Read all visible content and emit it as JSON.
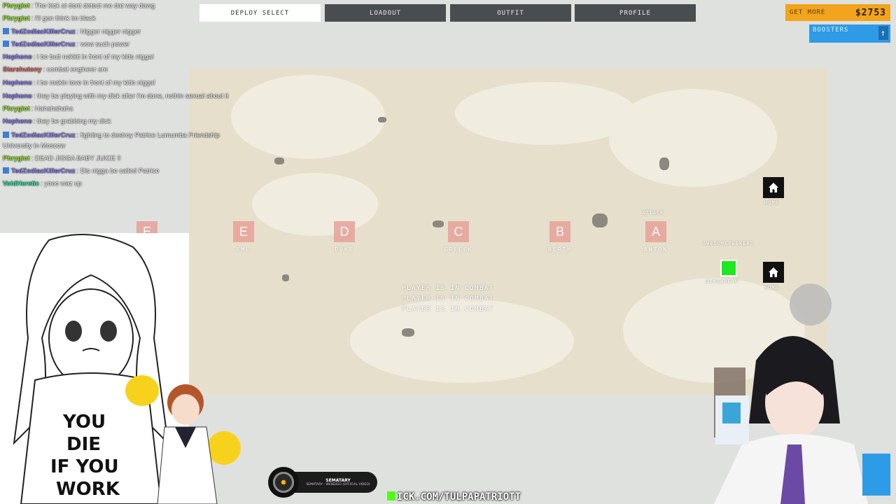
{
  "nav": {
    "tabs": [
      {
        "label": "DEPLOY SELECT",
        "active": true
      },
      {
        "label": "LOADOUT",
        "active": false
      },
      {
        "label": "OUTFIT",
        "active": false
      },
      {
        "label": "PROFILE",
        "active": false
      }
    ]
  },
  "currency": {
    "get_more_label": "GET MORE",
    "amount": "$2753",
    "accent": "#f2a41c"
  },
  "boosters": {
    "label": "BOOSTERS",
    "icon": "arrow-up-icon"
  },
  "map": {
    "flags": [
      {
        "letter": "E",
        "name": "EML"
      },
      {
        "letter": "D",
        "name": "DUKE"
      },
      {
        "letter": "C",
        "name": "CRECEK"
      },
      {
        "letter": "B",
        "name": "BERTH"
      },
      {
        "letter": "A",
        "name": "ANTON"
      }
    ],
    "combat_lines": [
      "PLAYER IS IN COMBAT",
      "PLAYER IS IN COMBAT",
      "PLAYER IS IN COMBAT"
    ],
    "home_label_1": "HOME",
    "home_label_2": "HOME",
    "attack_label": "ATTACK",
    "player_label": "DINGAREAU",
    "squad_label": "AWESOMEPEEKERS"
  },
  "chat": [
    {
      "user": "Phrygiot",
      "color": "#9ae62a",
      "badge": false,
      "msg": "The kick ai dont detect me dat way dawg"
    },
    {
      "user": "Phrygiot",
      "color": "#9ae62a",
      "badge": false,
      "msg": "i'll gon think im black"
    },
    {
      "user": "TedZodiacKillerCruz",
      "color": "#8a7cf0",
      "badge": true,
      "msg": "Nigger nigger nigger"
    },
    {
      "user": "TedZodiacKillerCruz",
      "color": "#8a7cf0",
      "badge": true,
      "msg": "wow such power"
    },
    {
      "user": "Hophono",
      "color": "#8a7cf0",
      "badge": false,
      "msg": "i be butt nekkit in front of my kids nigga!"
    },
    {
      "user": "Starshutony",
      "color": "#e07070",
      "badge": false,
      "msg": "combat engineer are"
    },
    {
      "user": "Hophono",
      "color": "#8a7cf0",
      "badge": false,
      "msg": "i be makin love in front of my kids nigga!"
    },
    {
      "user": "Hophono",
      "color": "#8a7cf0",
      "badge": false,
      "msg": "they be playing with my dick after i'm done, nothin sexual about it"
    },
    {
      "user": "Phrygiot",
      "color": "#9ae62a",
      "badge": false,
      "msg": "Hahahahaha"
    },
    {
      "user": "Hophono",
      "color": "#8a7cf0",
      "badge": false,
      "msg": "they be grabbing my dick"
    },
    {
      "user": "TedZodiacKillerCruz",
      "color": "#8a7cf0",
      "badge": true,
      "msg": "fighting to destroy Patrice Lumumba Friendship University in Moscow"
    },
    {
      "user": "Phrygiot",
      "color": "#9ae62a",
      "badge": false,
      "msg": "DEAD JIGGA BABY JUICE !!"
    },
    {
      "user": "TedZodiacKillerCruz",
      "color": "#8a7cf0",
      "badge": true,
      "msg": "Dis nigga be called Patrice"
    },
    {
      "user": "VoidHeretic",
      "color": "#2ee6a6",
      "badge": false,
      "msg": "yooo waz up"
    }
  ],
  "overlay": {
    "shirt_text": [
      "YOU",
      "DIE",
      "IF YOU",
      "WORK"
    ],
    "music_title": "SEMATARY",
    "music_subtitle": "SEMATARY - WENDIGO (OFFICIAL VIDEO)",
    "kick_url": "ICK.COM/TULPAPATRIOTT"
  }
}
